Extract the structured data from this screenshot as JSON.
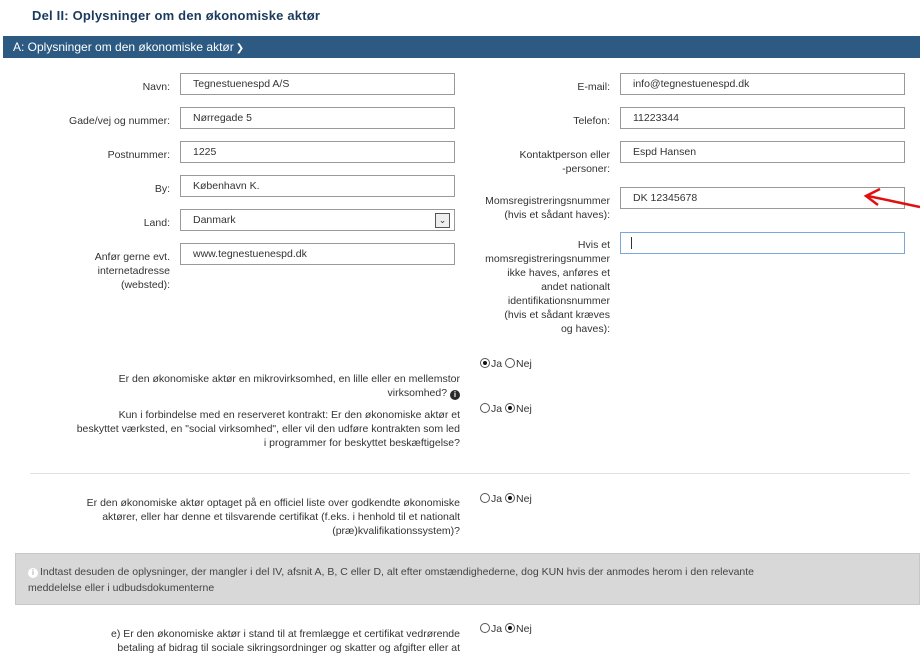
{
  "page_title": "Del II: Oplysninger om den økonomiske aktør",
  "section_header": "A: Oplysninger om den økonomiske aktør",
  "fields": {
    "navn": {
      "label": "Navn:",
      "value": "Tegnestuenespd A/S"
    },
    "gade": {
      "label": "Gade/vej og nummer:",
      "value": "Nørregade 5"
    },
    "postnummer": {
      "label": "Postnummer:",
      "value": "1225"
    },
    "by": {
      "label": "By:",
      "value": "København K."
    },
    "land": {
      "label": "Land:",
      "value": "Danmark"
    },
    "internet": {
      "label_lines": [
        "Anfør gerne evt.",
        "internetadresse",
        "(websted):"
      ],
      "value": "www.tegnestuenespd.dk"
    },
    "email": {
      "label": "E-mail:",
      "value": "info@tegnestuenespd.dk"
    },
    "telefon": {
      "label": "Telefon:",
      "value": "11223344"
    },
    "kontakt": {
      "label_lines": [
        "Kontaktperson eller",
        "-personer:"
      ],
      "value": "Espd Hansen"
    },
    "moms": {
      "label_lines": [
        "Momsregistreringsnummer",
        "(hvis et sådant haves):"
      ],
      "value": "DK 12345678"
    },
    "andet_id": {
      "label_lines": [
        "Hvis et",
        "momsregistreringsnummer",
        "ikke haves, anføres et",
        "andet nationalt",
        "identifikationsnummer",
        "(hvis et sådant kræves",
        "og haves):"
      ],
      "value": ""
    }
  },
  "radio_labels": {
    "ja": "Ja",
    "nej": "Nej"
  },
  "questions": [
    {
      "lines": [
        "Er den økonomiske aktør en mikrovirksomhed, en lille eller en mellemstor",
        "virksomhed?"
      ],
      "selected": "ja"
    },
    {
      "lines": [
        "Kun i forbindelse med en reserveret kontrakt: Er den økonomiske aktør et",
        "beskyttet værksted, en \"social virksomhed\", eller vil den udføre kontrakten som led",
        "i programmer for beskyttet beskæftigelse?"
      ],
      "selected": "nej"
    },
    {
      "lines": [
        "Er den økonomiske aktør optaget på en officiel liste over godkendte økonomiske",
        "aktører, eller har denne et tilsvarende certifikat (f.eks. i henhold til et nationalt",
        "(præ)kvalifikationssystem)?"
      ],
      "selected": "nej"
    },
    {
      "lines": [
        "e) Er den økonomiske aktør i stand til at fremlægge et certifikat vedrørende",
        "betaling af bidrag til sociale sikringsordninger og skatter og afgifter eller at"
      ],
      "selected": "nej"
    }
  ],
  "info_box": {
    "lines": [
      "Indtast desuden de oplysninger, der mangler i del IV, afsnit A, B, C eller D, alt efter omstændighederne, dog KUN hvis der anmodes herom i den relevante",
      "meddelelse eller i udbudsdokumenterne"
    ]
  },
  "colors": {
    "header_bg": "#2c5a83",
    "title": "#1b3a5c",
    "annotation_arrow": "#e01010"
  }
}
